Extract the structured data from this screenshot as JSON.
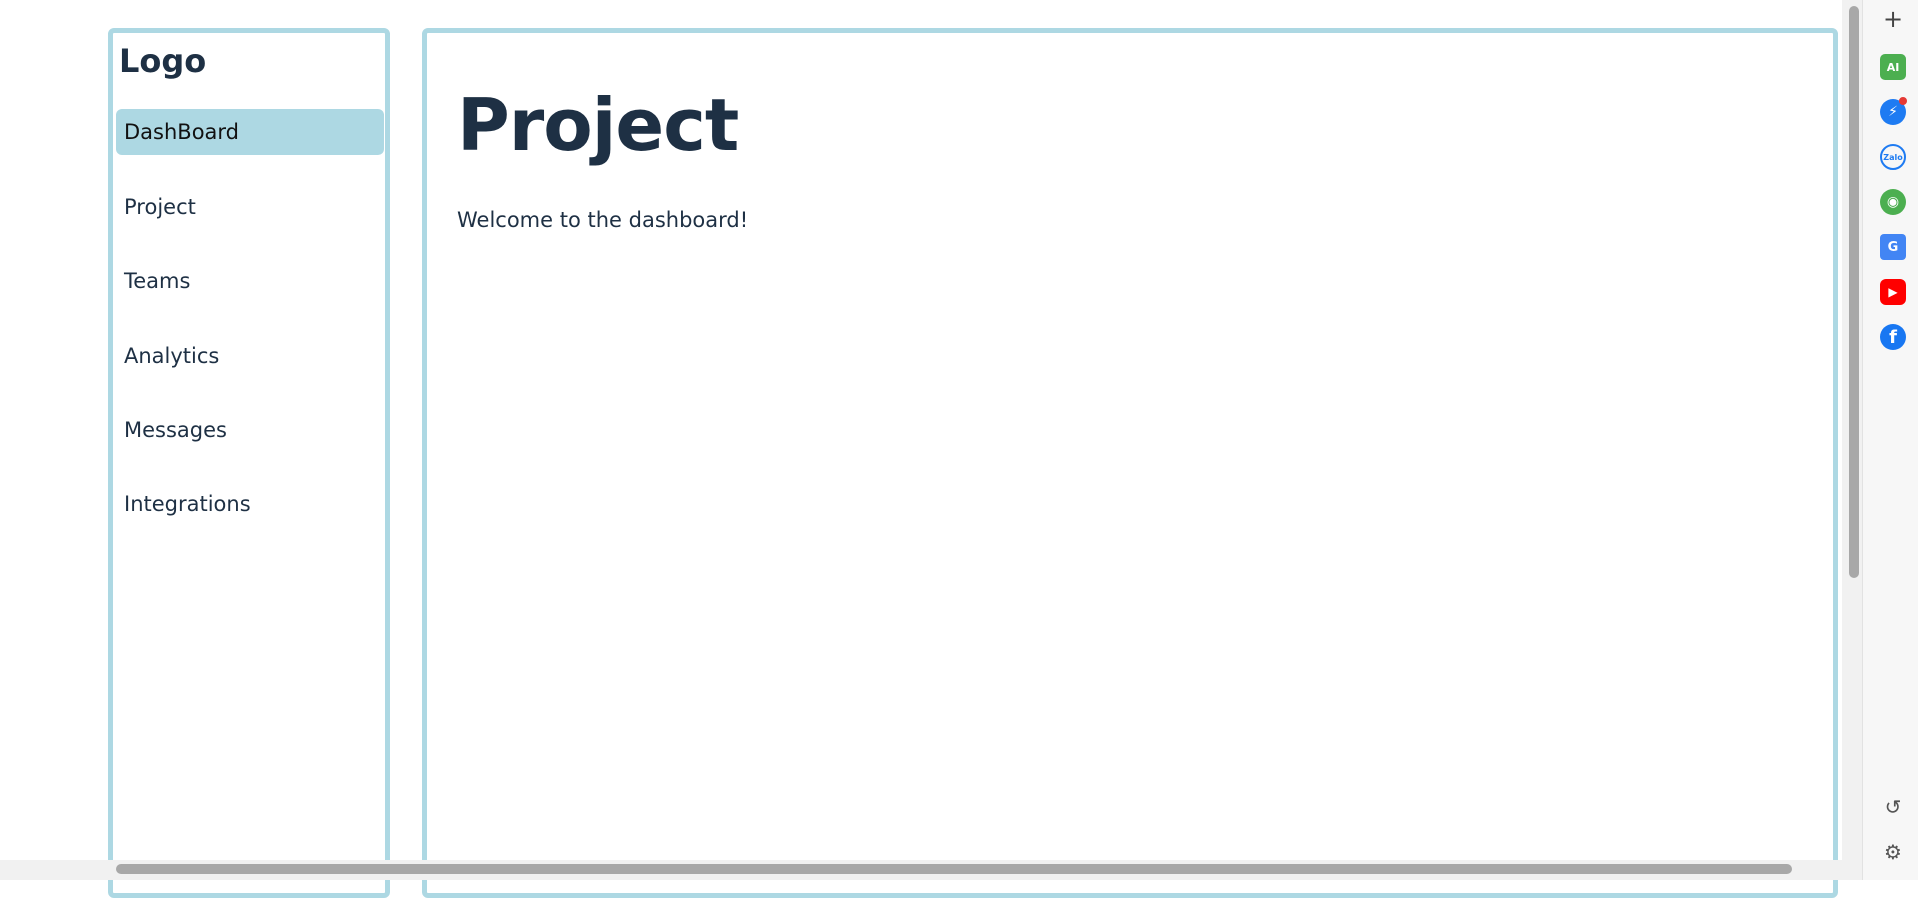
{
  "sidebar": {
    "logo": "Logo",
    "items": [
      {
        "label": "DashBoard",
        "active": true
      },
      {
        "label": "Project",
        "active": false
      },
      {
        "label": "Teams",
        "active": false
      },
      {
        "label": "Analytics",
        "active": false
      },
      {
        "label": "Messages",
        "active": false
      },
      {
        "label": "Integrations",
        "active": false
      }
    ]
  },
  "main": {
    "title": "Project",
    "welcome": "Welcome to the dashboard!"
  },
  "side_panel": {
    "top_icons": [
      "plus-icon",
      "ai-icon",
      "messenger-icon",
      "zalo-icon",
      "game-icon",
      "translate-icon",
      "youtube-icon",
      "facebook-icon"
    ],
    "bottom_icons": [
      "history-icon",
      "gear-icon"
    ],
    "ai_label": "AI",
    "zalo_label": "Zalo"
  },
  "colors": {
    "accent": "#add8e3",
    "text": "#1e3044"
  }
}
